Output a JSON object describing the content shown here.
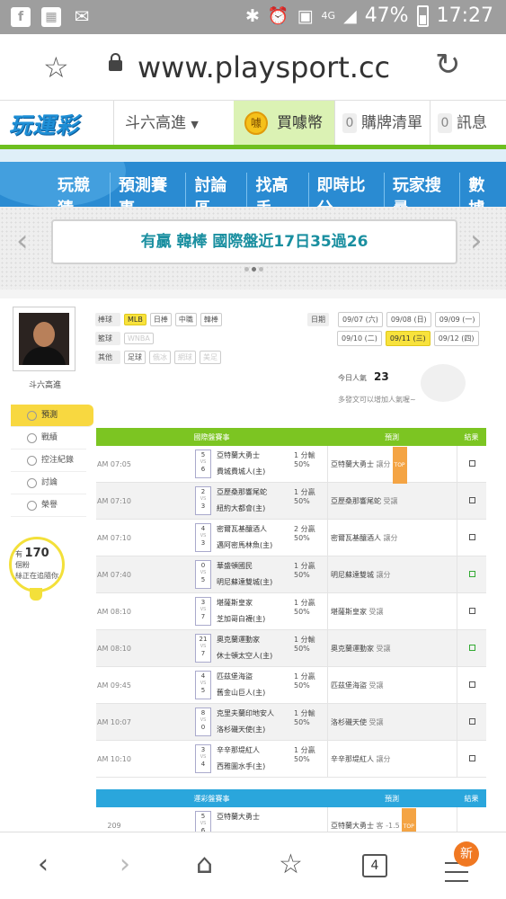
{
  "status_bar": {
    "battery": "47%",
    "time": "17:27",
    "signal": "4G"
  },
  "browser": {
    "url": "www.playsport.cc"
  },
  "site": {
    "logo": "玩運彩",
    "user": "斗六高進",
    "buy_label": "買噱幣",
    "coin_label": "噱",
    "cart_count": "0",
    "cart_label": "購牌清單",
    "msg_count": "0",
    "msg_label": "訊息"
  },
  "main_nav": [
    "玩競猜",
    "預測賽事",
    "討論區",
    "找高手",
    "即時比分",
    "玩家搜尋",
    "數據"
  ],
  "banner": {
    "text": "有贏 韓棒 國際盤近17日35過26"
  },
  "profile": {
    "name": "斗六高進"
  },
  "side_menu": [
    "預測",
    "戰績",
    "控注紀錄",
    "討論",
    "榮譽"
  ],
  "bulb": {
    "pre": "有",
    "count": "170",
    "unit": "個粉",
    "post": "絲正在追隨你"
  },
  "filters": {
    "baseball_label": "棒球",
    "baseball": [
      {
        "t": "MLB",
        "on": true
      },
      {
        "t": "日棒",
        "on": false
      },
      {
        "t": "中職",
        "on": false
      },
      {
        "t": "韓棒",
        "on": false
      }
    ],
    "basketball_label": "籃球",
    "basketball": [
      {
        "t": "WNBA",
        "dis": true
      }
    ],
    "other_label": "其他",
    "other": [
      {
        "t": "足球",
        "dis": false
      },
      {
        "t": "俄冰",
        "dis": true
      },
      {
        "t": "網球",
        "dis": true
      },
      {
        "t": "美足",
        "dis": true
      }
    ]
  },
  "dates": {
    "label": "日期",
    "row1": [
      "09/07 (六)",
      "09/08 (日)",
      "09/09 (一)"
    ],
    "row2": [
      "09/10 (二)",
      "09/11 (三)",
      "09/12 (四)"
    ],
    "selected": "09/11 (三)"
  },
  "popularity": {
    "label": "今日人氣",
    "value": "23",
    "hint": "多發文可以增加人氣喔~"
  },
  "table1": {
    "header": {
      "game": "國際盤賽事",
      "pick": "預測",
      "result": "結果"
    },
    "rows": [
      {
        "time": "AM 07:05",
        "s1": "5",
        "s2": "6",
        "t1": "亞特蘭大勇士",
        "t2": "費城費城人(主)",
        "line": "1 分輸50%",
        "pick": "亞特蘭大勇士",
        "note": "讓分",
        "tag": "TOP",
        "res": "box"
      },
      {
        "time": "AM 07:10",
        "s1": "2",
        "s2": "3",
        "t1": "亞歷桑那響尾蛇",
        "t2": "紐約大都會(主)",
        "line": "1 分贏50%",
        "pick": "亞歷桑那響尾蛇",
        "note": "受讓",
        "tag": "",
        "res": "box"
      },
      {
        "time": "AM 07:10",
        "s1": "4",
        "s2": "3",
        "t1": "密爾瓦基釀酒人",
        "t2": "邁阿密馬林魚(主)",
        "line": "2 分贏50%",
        "pick": "密爾瓦基釀酒人",
        "note": "讓分",
        "tag": "",
        "res": "box"
      },
      {
        "time": "AM 07:40",
        "s1": "0",
        "s2": "5",
        "t1": "華盛頓國民",
        "t2": "明尼蘇達雙城(主)",
        "line": "1 分贏50%",
        "pick": "明尼蘇達雙城",
        "note": "讓分",
        "tag": "",
        "res": "green"
      },
      {
        "time": "AM 08:10",
        "s1": "3",
        "s2": "7",
        "t1": "堪薩斯皇家",
        "t2": "芝加哥白襪(主)",
        "line": "1 分贏50%",
        "pick": "堪薩斯皇家",
        "note": "受讓",
        "tag": "",
        "res": "box"
      },
      {
        "time": "AM 08:10",
        "s1": "21",
        "s2": "7",
        "t1": "奧克蘭運動家",
        "t2": "休士頓太空人(主)",
        "line": "1 分輸50%",
        "pick": "奧克蘭運動家",
        "note": "受讓",
        "tag": "",
        "res": "green"
      },
      {
        "time": "AM 09:45",
        "s1": "4",
        "s2": "5",
        "t1": "匹茲堡海盜",
        "t2": "舊金山巨人(主)",
        "line": "1 分贏50%",
        "pick": "匹茲堡海盜",
        "note": "受讓",
        "tag": "",
        "res": "box"
      },
      {
        "time": "AM 10:07",
        "s1": "8",
        "s2": "0",
        "t1": "克里夫蘭印地安人",
        "t2": "洛杉磯天使(主)",
        "line": "1 分輸50%",
        "pick": "洛杉磯天使",
        "note": "受讓",
        "tag": "",
        "res": "box"
      },
      {
        "time": "AM 10:10",
        "s1": "3",
        "s2": "4",
        "t1": "辛辛那堤紅人",
        "t2": "西雅圖水手(主)",
        "line": "1 分贏50%",
        "pick": "辛辛那堤紅人",
        "note": "讓分",
        "tag": "",
        "res": "box"
      }
    ]
  },
  "table2": {
    "header": {
      "game": "運彩盤賽事",
      "pick": "預測",
      "result": "結果"
    },
    "row": {
      "num": "209",
      "s1": "5",
      "s2": "6",
      "t1": "亞特蘭大勇士",
      "pick": "亞特蘭大勇士",
      "note": "客 -1.5",
      "tag": "TOP"
    }
  },
  "vs_label": "VS",
  "bottom_nav": {
    "tabs": "4",
    "new_badge": "新"
  }
}
